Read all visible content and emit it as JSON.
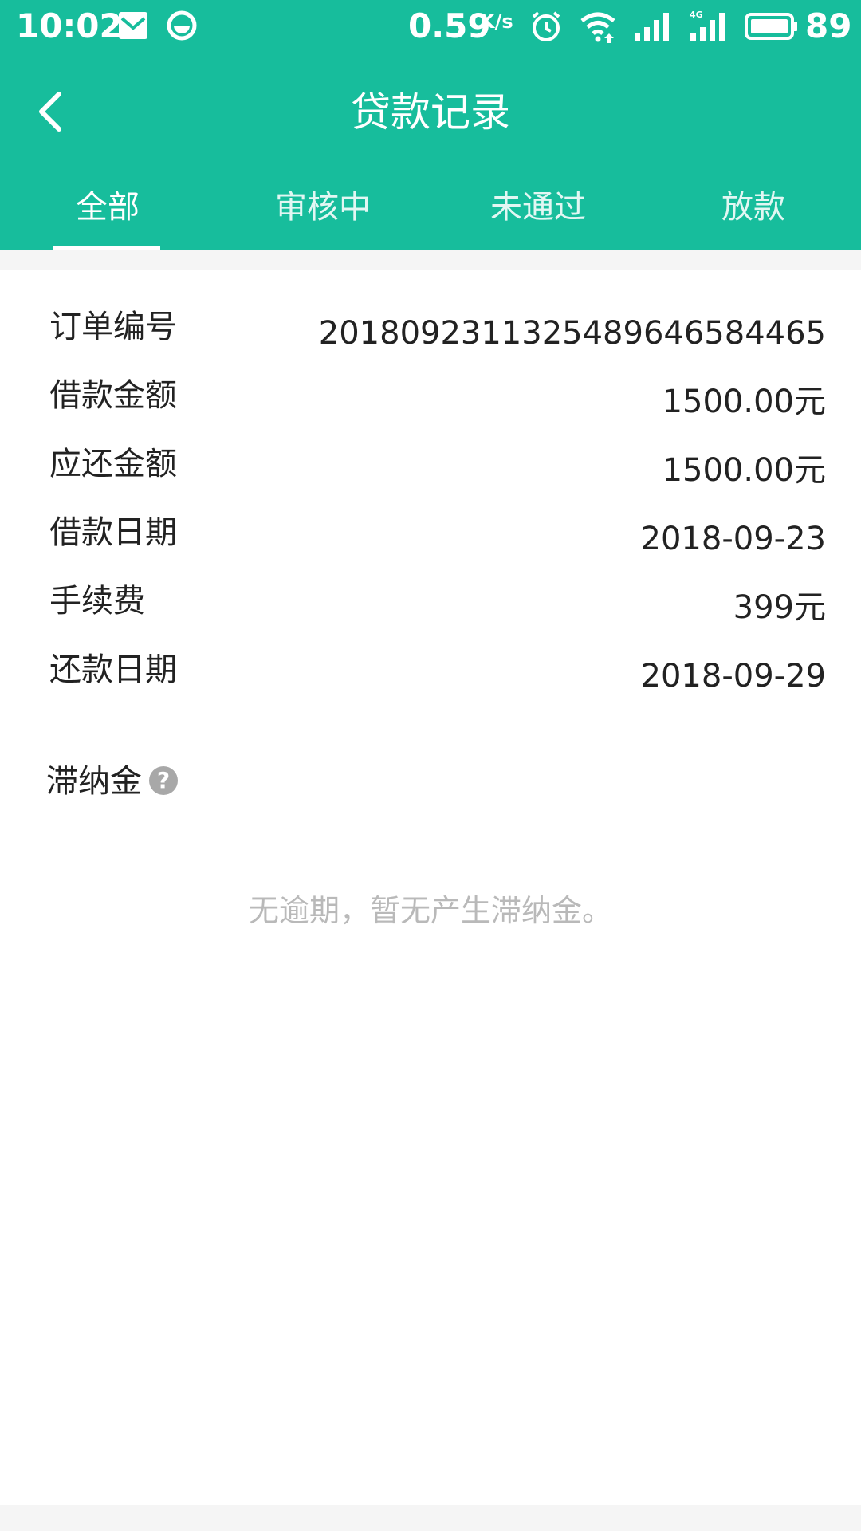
{
  "status_bar": {
    "time": "10:02",
    "net_speed": "0.59",
    "net_speed_unit": "K/s",
    "battery": "89",
    "icons": [
      "mail-icon",
      "app-notification-icon",
      "alarm-icon",
      "wifi-icon",
      "signal-icon",
      "4g-signal-icon",
      "battery-icon"
    ]
  },
  "nav": {
    "title": "贷款记录",
    "back_icon": "chevron-left-icon"
  },
  "tabs": [
    {
      "label": "全部",
      "active": true
    },
    {
      "label": "审核中",
      "active": false
    },
    {
      "label": "未通过",
      "active": false
    },
    {
      "label": "放款",
      "active": false
    }
  ],
  "details": [
    {
      "label": "订单编号",
      "value": "20180923113254896465844​65"
    },
    {
      "label": "借款金额",
      "value": "1500.00元"
    },
    {
      "label": "应还金额",
      "value": "1500.00元"
    },
    {
      "label": "借款日期",
      "value": "2018-09-23"
    },
    {
      "label": "手续费",
      "value": "399元"
    },
    {
      "label": "还款日期",
      "value": "2018-09-29"
    }
  ],
  "late_fee": {
    "label": "滞纳金",
    "help_icon": "question-circle-icon",
    "empty_note": "无逾期，暂无产生滞纳金。"
  },
  "colors": {
    "brand": "#17bd9c",
    "text": "#222222",
    "muted": "#b9b9b9"
  }
}
